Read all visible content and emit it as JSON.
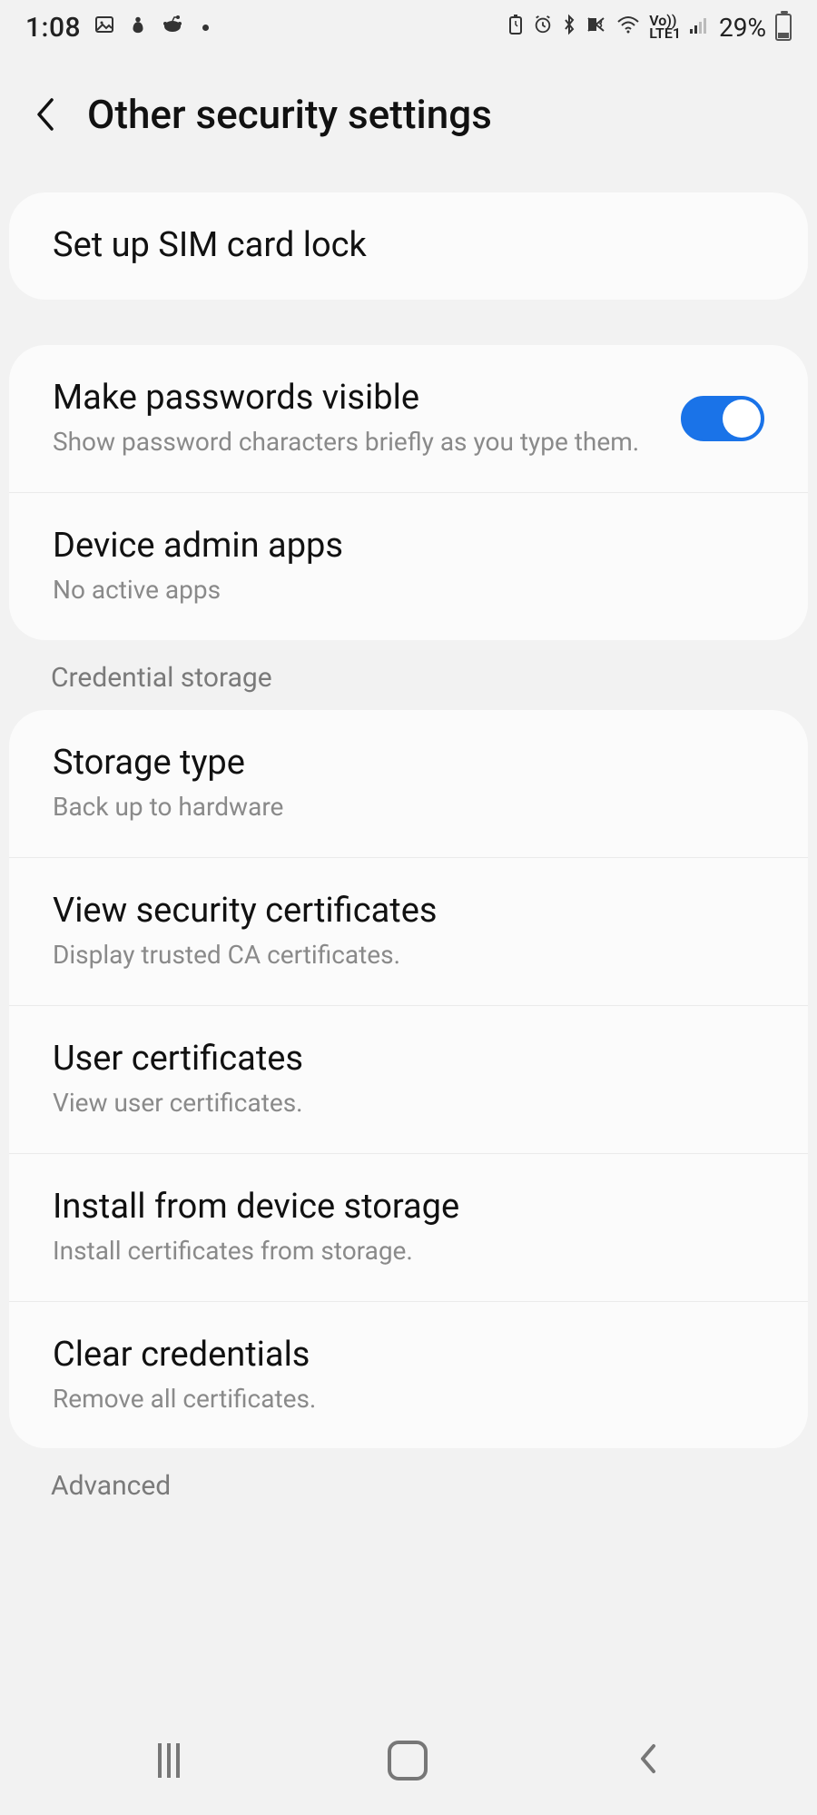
{
  "status": {
    "time": "1:08",
    "battery_percent": "29%"
  },
  "header": {
    "title": "Other security settings"
  },
  "groups": {
    "sim": {
      "title": "Set up SIM card lock"
    },
    "passwords_visible": {
      "title": "Make passwords visible",
      "subtitle": "Show password characters briefly as you type them.",
      "enabled": true
    },
    "device_admin": {
      "title": "Device admin apps",
      "subtitle": "No active apps"
    }
  },
  "sections": {
    "credential_storage": "Credential storage",
    "advanced": "Advanced"
  },
  "credential": {
    "storage_type": {
      "title": "Storage type",
      "subtitle": "Back up to hardware"
    },
    "view_certs": {
      "title": "View security certificates",
      "subtitle": "Display trusted CA certificates."
    },
    "user_certs": {
      "title": "User certificates",
      "subtitle": "View user certificates."
    },
    "install": {
      "title": "Install from device storage",
      "subtitle": "Install certificates from storage."
    },
    "clear": {
      "title": "Clear credentials",
      "subtitle": "Remove all certificates."
    }
  }
}
